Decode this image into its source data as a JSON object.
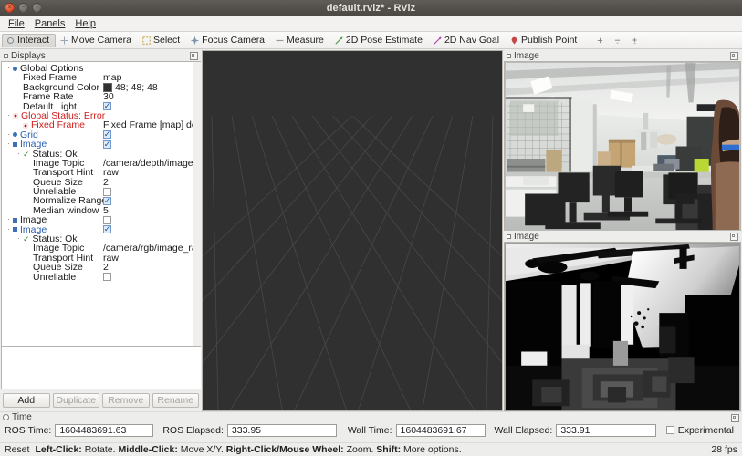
{
  "window": {
    "title": "default.rviz* - RViz",
    "buttons": [
      "close",
      "minimize",
      "maximize"
    ]
  },
  "menubar": {
    "items": [
      {
        "label": "File",
        "mnemonic": "F"
      },
      {
        "label": "Panels",
        "mnemonic": "P"
      },
      {
        "label": "Help",
        "mnemonic": "H"
      }
    ]
  },
  "toolbar": {
    "tools": [
      {
        "label": "Interact",
        "icon": "interact-icon",
        "active": true
      },
      {
        "label": "Move Camera",
        "icon": "move-camera-icon",
        "active": false
      },
      {
        "label": "Select",
        "icon": "select-icon",
        "active": false
      },
      {
        "label": "Focus Camera",
        "icon": "focus-camera-icon",
        "active": false
      },
      {
        "label": "Measure",
        "icon": "measure-icon",
        "active": false
      },
      {
        "label": "2D Pose Estimate",
        "icon": "pose-estimate-icon",
        "active": false
      },
      {
        "label": "2D Nav Goal",
        "icon": "nav-goal-icon",
        "active": false
      },
      {
        "label": "Publish Point",
        "icon": "publish-point-icon",
        "active": false
      }
    ],
    "extra_icons": [
      "add-tool-icon",
      "remove-tool-icon",
      "tool-properties-icon"
    ]
  },
  "displays": {
    "title": "Displays",
    "tree": [
      {
        "indent": 0,
        "expander": "-",
        "marker": "dot",
        "label": "Global Options",
        "label_color": "dark",
        "value_type": "none",
        "value": ""
      },
      {
        "indent": 1,
        "expander": "",
        "marker": "none",
        "label": "Fixed Frame",
        "label_color": "dark",
        "value_type": "text",
        "value": "map"
      },
      {
        "indent": 1,
        "expander": "",
        "marker": "none",
        "label": "Background Color",
        "label_color": "dark",
        "value_type": "color",
        "value": "48; 48; 48",
        "swatch": "#303030"
      },
      {
        "indent": 1,
        "expander": "",
        "marker": "none",
        "label": "Frame Rate",
        "label_color": "dark",
        "value_type": "text",
        "value": "30"
      },
      {
        "indent": 1,
        "expander": "",
        "marker": "none",
        "label": "Default Light",
        "label_color": "dark",
        "value_type": "check",
        "value": "checked"
      },
      {
        "indent": 0,
        "expander": "-",
        "marker": "error",
        "label": "Global Status: Error",
        "label_color": "red",
        "value_type": "none",
        "value": ""
      },
      {
        "indent": 1,
        "expander": "",
        "marker": "error",
        "label": "Fixed Frame",
        "label_color": "red",
        "value_type": "text",
        "value": "Fixed Frame [map] does n..."
      },
      {
        "indent": 0,
        "expander": "-",
        "marker": "dot",
        "label": "Grid",
        "label_color": "blue",
        "value_type": "check",
        "value": "checked"
      },
      {
        "indent": 0,
        "expander": "-",
        "marker": "square",
        "label": "Image",
        "label_color": "blue",
        "value_type": "check",
        "value": "checked"
      },
      {
        "indent": 1,
        "expander": "-",
        "marker": "ok",
        "label": "Status: Ok",
        "label_color": "dark",
        "value_type": "none",
        "value": ""
      },
      {
        "indent": 2,
        "expander": "",
        "marker": "none",
        "label": "Image Topic",
        "label_color": "dark",
        "value_type": "text",
        "value": "/camera/depth/image"
      },
      {
        "indent": 2,
        "expander": "",
        "marker": "none",
        "label": "Transport Hint",
        "label_color": "dark",
        "value_type": "text",
        "value": "raw"
      },
      {
        "indent": 2,
        "expander": "",
        "marker": "none",
        "label": "Queue Size",
        "label_color": "dark",
        "value_type": "text",
        "value": "2"
      },
      {
        "indent": 2,
        "expander": "",
        "marker": "none",
        "label": "Unreliable",
        "label_color": "dark",
        "value_type": "check",
        "value": "unchecked"
      },
      {
        "indent": 2,
        "expander": "",
        "marker": "none",
        "label": "Normalize Range",
        "label_color": "dark",
        "value_type": "check",
        "value": "checked"
      },
      {
        "indent": 2,
        "expander": "",
        "marker": "none",
        "label": "Median window",
        "label_color": "dark",
        "value_type": "text",
        "value": "5"
      },
      {
        "indent": 0,
        "expander": "-",
        "marker": "square",
        "label": "Image",
        "label_color": "dark",
        "value_type": "check",
        "value": "unchecked"
      },
      {
        "indent": 0,
        "expander": "-",
        "marker": "square",
        "label": "Image",
        "label_color": "blue",
        "value_type": "check",
        "value": "checked"
      },
      {
        "indent": 1,
        "expander": "-",
        "marker": "ok",
        "label": "Status: Ok",
        "label_color": "dark",
        "value_type": "none",
        "value": ""
      },
      {
        "indent": 2,
        "expander": "",
        "marker": "none",
        "label": "Image Topic",
        "label_color": "dark",
        "value_type": "text",
        "value": "/camera/rgb/image_raw"
      },
      {
        "indent": 2,
        "expander": "",
        "marker": "none",
        "label": "Transport Hint",
        "label_color": "dark",
        "value_type": "text",
        "value": "raw"
      },
      {
        "indent": 2,
        "expander": "",
        "marker": "none",
        "label": "Queue Size",
        "label_color": "dark",
        "value_type": "text",
        "value": "2"
      },
      {
        "indent": 2,
        "expander": "",
        "marker": "none",
        "label": "Unreliable",
        "label_color": "dark",
        "value_type": "check",
        "value": "unchecked"
      }
    ],
    "buttons": [
      {
        "label": "Add",
        "enabled": true
      },
      {
        "label": "Duplicate",
        "enabled": false
      },
      {
        "label": "Remove",
        "enabled": false
      },
      {
        "label": "Rename",
        "enabled": false
      }
    ]
  },
  "viewport": {
    "background_color": "#303030",
    "grid_color": "#4c4c4c"
  },
  "image_panels": [
    {
      "title": "Image",
      "content": "rgb-camera-view"
    },
    {
      "title": "Image",
      "content": "depth-camera-view"
    }
  ],
  "time_panel": {
    "title": "Time",
    "fields": [
      {
        "label": "ROS Time:",
        "value": "1604483691.63"
      },
      {
        "label": "ROS Elapsed:",
        "value": "333.95"
      },
      {
        "label": "Wall Time:",
        "value": "1604483691.67"
      },
      {
        "label": "Wall Elapsed:",
        "value": "333.91"
      }
    ],
    "experimental": {
      "label": "Experimental",
      "checked": false
    }
  },
  "statusbar": {
    "reset_label": "Reset",
    "hint_parts": [
      {
        "text": "Left-Click:",
        "bold": true
      },
      {
        "text": " Rotate. ",
        "bold": false
      },
      {
        "text": "Middle-Click:",
        "bold": true
      },
      {
        "text": " Move X/Y. ",
        "bold": false
      },
      {
        "text": "Right-Click/Mouse Wheel:",
        "bold": true
      },
      {
        "text": " Zoom. ",
        "bold": false
      },
      {
        "text": "Shift:",
        "bold": true
      },
      {
        "text": " More options.",
        "bold": false
      }
    ],
    "fps": "28 fps"
  }
}
